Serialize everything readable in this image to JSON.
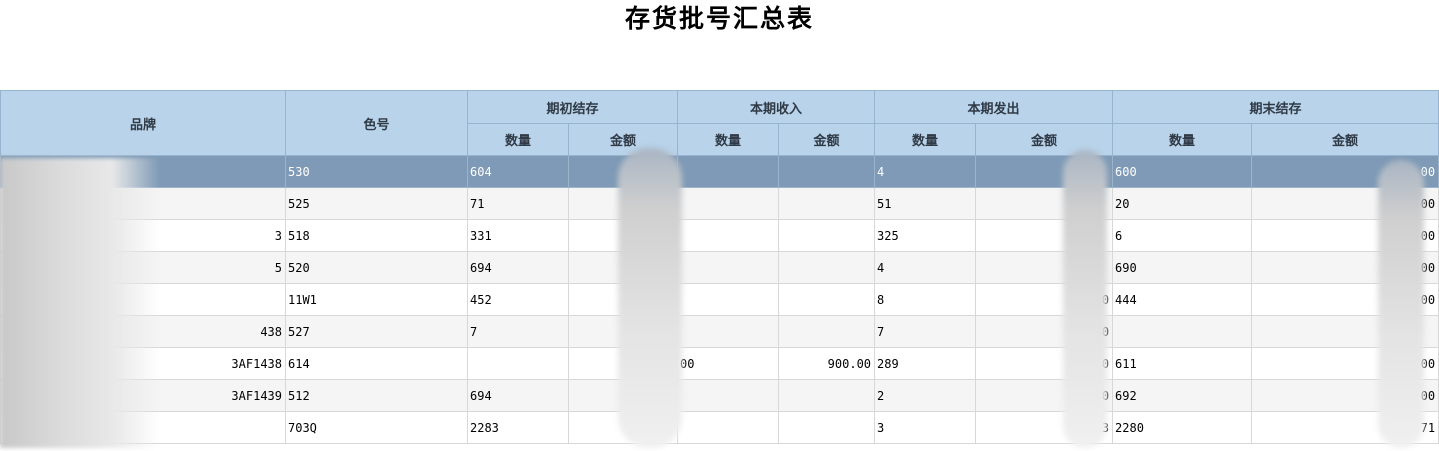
{
  "title": "存货批号汇总表",
  "columns": {
    "brand": "品牌",
    "color_code": "色号",
    "opening": "期初结存",
    "income": "本期收入",
    "issue": "本期发出",
    "closing": "期末结存",
    "qty": "数量",
    "amount": "金额"
  },
  "rows": [
    {
      "brand": "",
      "color": "530",
      "open_qty": "604",
      "open_amt": "",
      "in_qty": "",
      "in_amt": "",
      "out_qty": "4",
      "out_amt": "",
      "close_qty": "600",
      "close_amt": ".00"
    },
    {
      "brand": "",
      "color": "525",
      "open_qty": "71",
      "open_amt": "",
      "in_qty": "",
      "in_amt": "",
      "out_qty": "51",
      "out_amt": "",
      "close_qty": "20",
      "close_amt": ".00"
    },
    {
      "brand": "3",
      "color": "518",
      "open_qty": "331",
      "open_amt": "",
      "in_qty": "",
      "in_amt": "",
      "out_qty": "325",
      "out_amt": "",
      "close_qty": "6",
      "close_amt": ".00"
    },
    {
      "brand": "5",
      "color": "520",
      "open_qty": "694",
      "open_amt": "",
      "in_qty": "",
      "in_amt": "",
      "out_qty": "4",
      "out_amt": "",
      "close_qty": "690",
      "close_amt": "00"
    },
    {
      "brand": "",
      "color": "11W1",
      "open_qty": "452",
      "open_amt": "",
      "in_qty": "",
      "in_amt": "",
      "out_qty": "8",
      "out_amt": "0",
      "close_qty": "444",
      "close_amt": "00"
    },
    {
      "brand": "438",
      "color": "527",
      "open_qty": "7",
      "open_amt": "",
      "in_qty": "",
      "in_amt": "",
      "out_qty": "7",
      "out_amt": "0",
      "close_qty": "",
      "close_amt": ""
    },
    {
      "brand": "3AF1438",
      "color": "614",
      "open_qty": "",
      "open_amt": "",
      "in_qty": "00",
      "in_amt": "900.00",
      "out_qty": "289",
      "out_amt": "0",
      "close_qty": "611",
      "close_amt": "00"
    },
    {
      "brand": "3AF1439",
      "color": "512",
      "open_qty": "694",
      "open_amt": "",
      "in_qty": "",
      "in_amt": "",
      "out_qty": "2",
      "out_amt": "0",
      "close_qty": "692",
      "close_amt": "00"
    },
    {
      "brand": "",
      "color": "703Q",
      "open_qty": "2283",
      "open_amt": "",
      "in_qty": "",
      "in_amt": "",
      "out_qty": "3",
      "out_amt": "3",
      "close_qty": "2280",
      "close_amt": "71"
    }
  ]
}
